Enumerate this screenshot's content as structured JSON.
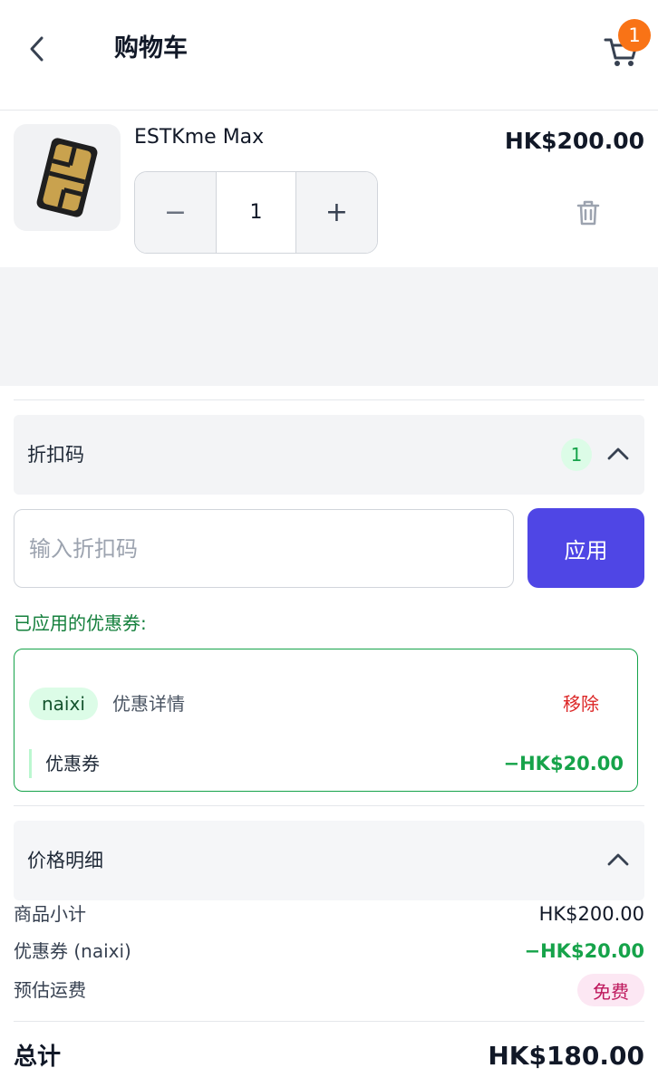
{
  "header": {
    "title": "购物车",
    "cart_count": "1"
  },
  "product": {
    "name": "ESTKme Max",
    "price": "HK$200.00",
    "quantity": "1",
    "minus": "−",
    "plus": "+"
  },
  "discount": {
    "title": "折扣码",
    "count": "1",
    "input_placeholder": "输入折扣码",
    "apply_label": "应用",
    "applied_label": "已应用的优惠券:",
    "coupon": {
      "code": "naixi",
      "detail_label": "优惠详情",
      "remove_label": "移除",
      "row_label": "优惠券",
      "row_value": "−HK$20.00"
    }
  },
  "breakdown": {
    "title": "价格明细",
    "subtotal_label": "商品小计",
    "subtotal_value": "HK$200.00",
    "coupon_label": "优惠券 (naixi)",
    "coupon_value": "−HK$20.00",
    "shipping_label": "预估运费",
    "shipping_value": "免费",
    "total_label": "总计",
    "total_value": "HK$180.00"
  },
  "colors": {
    "accent": "#4f46e5",
    "success": "#16a34a",
    "badge": "#f97316",
    "danger": "#dc2626"
  }
}
